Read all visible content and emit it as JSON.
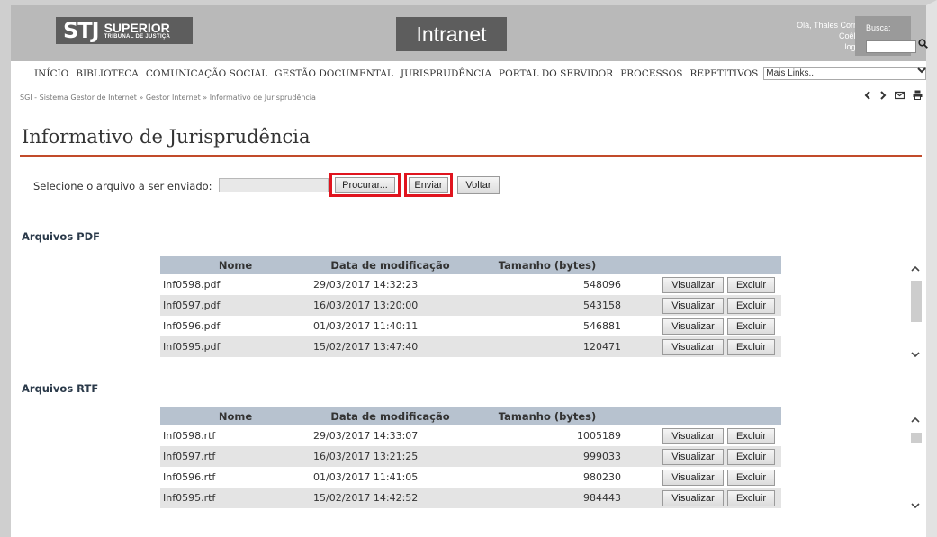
{
  "header": {
    "logo": {
      "stj": "STJ",
      "superior": "SUPERIOR",
      "tribunal": "TRIBUNAL DE JUSTIÇA"
    },
    "app_title": "Intranet",
    "user": {
      "greeting": "Olá, Thales Correia",
      "surname": "Coêlho!",
      "logout": "logout"
    },
    "search": {
      "label": "Busca:",
      "value": "",
      "icon": "search-icon"
    }
  },
  "menu": {
    "items": [
      "INÍCIO",
      "BIBLIOTECA",
      "COMUNICAÇÃO SOCIAL",
      "GESTÃO DOCUMENTAL",
      "JURISPRUDÊNCIA",
      "PORTAL DO SERVIDOR",
      "PROCESSOS",
      "REPETITIVOS"
    ],
    "more_select": "Mais Links..."
  },
  "breadcrumb": {
    "text": "SGI - Sistema Gestor de Internet » Gestor Internet » Informativo de Jurisprudência"
  },
  "toolbar_icons": [
    "chevron-left-icon",
    "chevron-right-icon",
    "mail-icon",
    "print-icon"
  ],
  "page_title": "Informativo de Jurisprudência",
  "upload": {
    "label": "Selecione o arquivo a ser enviado:",
    "file_value": "",
    "browse": "Procurar...",
    "send": "Enviar",
    "back": "Voltar",
    "highlight_color": "#e0141e"
  },
  "columns": [
    "Nome",
    "Data de modificação",
    "Tamanho (bytes)",
    ""
  ],
  "pdf": {
    "title": "Arquivos PDF",
    "rows": [
      {
        "name": "Inf0598.pdf",
        "date": "29/03/2017 14:32:23",
        "size": "548096",
        "view": "Visualizar",
        "del": "Excluir"
      },
      {
        "name": "Inf0597.pdf",
        "date": "16/03/2017 13:20:00",
        "size": "543158",
        "view": "Visualizar",
        "del": "Excluir"
      },
      {
        "name": "Inf0596.pdf",
        "date": "01/03/2017 11:40:11",
        "size": "546881",
        "view": "Visualizar",
        "del": "Excluir"
      },
      {
        "name": "Inf0595.pdf",
        "date": "15/02/2017 13:47:40",
        "size": "120471",
        "view": "Visualizar",
        "del": "Excluir"
      }
    ]
  },
  "rtf": {
    "title": "Arquivos RTF",
    "rows": [
      {
        "name": "Inf0598.rtf",
        "date": "29/03/2017 14:33:07",
        "size": "1005189",
        "view": "Visualizar",
        "del": "Excluir"
      },
      {
        "name": "Inf0597.rtf",
        "date": "16/03/2017 13:21:25",
        "size": "999033",
        "view": "Visualizar",
        "del": "Excluir"
      },
      {
        "name": "Inf0596.rtf",
        "date": "01/03/2017 11:41:05",
        "size": "980230",
        "view": "Visualizar",
        "del": "Excluir"
      },
      {
        "name": "Inf0595.rtf",
        "date": "15/02/2017 14:42:52",
        "size": "984443",
        "view": "Visualizar",
        "del": "Excluir"
      }
    ]
  },
  "colors": {
    "header_bg": "#b9b9b9",
    "logo_bg": "#5d5d5d",
    "title_rule": "#c24b2a",
    "table_header": "#b7c2cf",
    "row_alt": "#e4e4e4"
  }
}
